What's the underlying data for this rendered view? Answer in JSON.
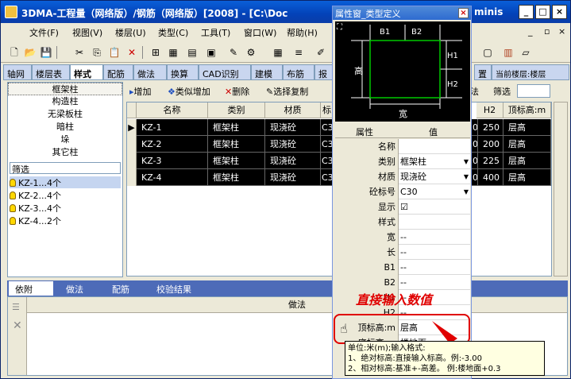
{
  "window": {
    "title": "3DMA-工程量（网络版）/钢筋（网络版）[2008] - [C:\\Doc",
    "title_tail": "minis",
    "controls": [
      "_",
      "□",
      "×"
    ],
    "mdi_controls": [
      "_",
      "▫",
      "×"
    ]
  },
  "menu": [
    "文件(F)",
    "视图(V)",
    "楼层(U)",
    "类型(C)",
    "工具(T)",
    "窗口(W)",
    "帮助(H)"
  ],
  "tabs": [
    "轴网",
    "楼层表",
    "样式",
    "配筋",
    "做法",
    "换算",
    "CAD识别",
    "建模",
    "布筋",
    "报"
  ],
  "tabs_active": 2,
  "right_tabs": {
    "settings": "置",
    "current_floor": "当前楼层:楼层"
  },
  "categories": [
    "框架柱",
    "构造柱",
    "无梁板柱",
    "暗柱",
    "垛",
    "其它柱"
  ],
  "categories_selected": 0,
  "filter_label": "筛选",
  "members": [
    "KZ-1...4个",
    "KZ-2...4个",
    "KZ-3...4个",
    "KZ-4...2个"
  ],
  "actions": {
    "add": "增加",
    "similar_add": "类似增加",
    "delete": "删除",
    "select_copy": "选择复制",
    "method": "做法",
    "filter": "筛选"
  },
  "grid": {
    "headers": [
      "名称",
      "类别",
      "材质",
      "标",
      "H2",
      "顶标高:m"
    ],
    "rows": [
      {
        "name": "KZ-1",
        "type": "框架柱",
        "material": "现浇砼",
        "grade": "C3",
        "h2": "250",
        "top": "层高"
      },
      {
        "name": "KZ-2",
        "type": "框架柱",
        "material": "现浇砼",
        "grade": "C3",
        "h2": "200",
        "top": "层高"
      },
      {
        "name": "KZ-3",
        "type": "框架柱",
        "material": "现浇砼",
        "grade": "C3",
        "h2": "225",
        "top": "层高"
      },
      {
        "name": "KZ-4",
        "type": "框架柱",
        "material": "现浇砼",
        "grade": "C3",
        "h2": "400",
        "top": "层高"
      }
    ],
    "h2_prefix": "0"
  },
  "bottom": {
    "tabs": [
      "依附",
      "做法",
      "配筋",
      "校验结果"
    ],
    "active": 0,
    "column": "做法"
  },
  "property_window": {
    "title": "属性窗_类型定义",
    "preview_labels": {
      "b1": "B1",
      "b2": "B2",
      "h1": "H1",
      "h2": "H2",
      "height": "高",
      "width": "宽"
    },
    "header_name": "属性",
    "header_value": "值",
    "rows": [
      {
        "name": "名称",
        "value": ""
      },
      {
        "name": "类别",
        "value": "框架柱",
        "dropdown": true
      },
      {
        "name": "材质",
        "value": "现浇砼",
        "dropdown": true
      },
      {
        "name": "砼标号",
        "value": "C30",
        "dropdown": true
      },
      {
        "name": "显示",
        "value": "☑"
      },
      {
        "name": "样式",
        "value": ""
      },
      {
        "name": "宽",
        "value": "--"
      },
      {
        "name": "长",
        "value": "--"
      },
      {
        "name": "B1",
        "value": "--"
      },
      {
        "name": "B2",
        "value": "--"
      },
      {
        "name": "H1",
        "value": "--"
      },
      {
        "name": "H2",
        "value": "--"
      },
      {
        "name": "顶标高:m",
        "value": "层高"
      },
      {
        "name": "底标高:m",
        "value": "楼地面"
      }
    ]
  },
  "annotation": "直接输入数值",
  "hint": [
    "单位:米(m);输入格式:",
    "1、绝对标高:直接输入标高。例:-3.00",
    "2、相对标高:基准+-高差。  例:楼地面+0.3"
  ],
  "colors": {
    "title_bar": "#0a5fd8",
    "annotation": "#e00000",
    "grid_row_bg": "#000000"
  }
}
